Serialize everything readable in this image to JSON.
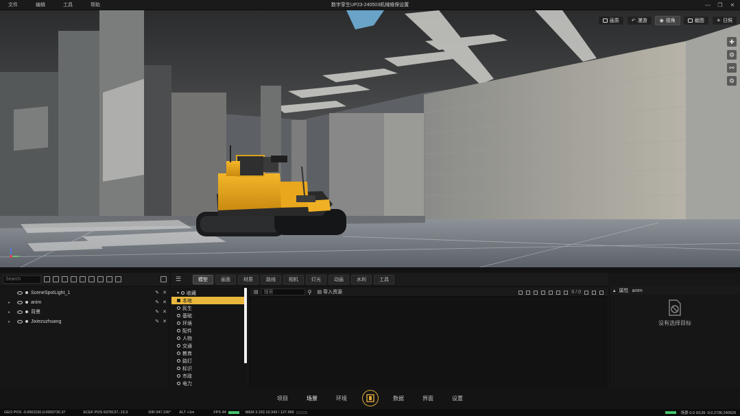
{
  "titlebar": {
    "menu": [
      "文件",
      "编辑",
      "工具",
      "帮助"
    ],
    "title": "数字孪生UP23-240503机械维保设置"
  },
  "viewport": {
    "toolbar": [
      {
        "label": "画质",
        "icon": "image-icon"
      },
      {
        "label": "漫游",
        "icon": "walk-icon"
      },
      {
        "label": "视角",
        "icon": "eye-icon"
      },
      {
        "label": "截图",
        "icon": "camera-icon"
      },
      {
        "label": "日照",
        "icon": "sun-icon"
      }
    ],
    "side_tools": [
      "move-icon",
      "gear-icon",
      "person-icon",
      "settings-icon"
    ]
  },
  "outliner": {
    "search_placeholder": "Search",
    "items": [
      {
        "name": "SceneSpotLight_1",
        "expandable": false
      },
      {
        "name": "anim",
        "expandable": true
      },
      {
        "name": "背景",
        "expandable": true
      },
      {
        "name": "Jixiezuzhuang",
        "expandable": true
      }
    ]
  },
  "library": {
    "tabs": [
      {
        "label": "模型",
        "active": true
      },
      {
        "label": "画面",
        "active": false
      },
      {
        "label": "材质",
        "active": false
      },
      {
        "label": "路线",
        "active": false
      },
      {
        "label": "相机",
        "active": false
      },
      {
        "label": "灯光",
        "active": false
      },
      {
        "label": "动画",
        "active": false
      },
      {
        "label": "水利",
        "active": false
      },
      {
        "label": "工具",
        "active": false
      }
    ],
    "categories": [
      {
        "label": "收藏",
        "selected": false,
        "group": true
      },
      {
        "label": "本地",
        "selected": true
      },
      {
        "label": "民生",
        "selected": false
      },
      {
        "label": "基础",
        "selected": false
      },
      {
        "label": "环境",
        "selected": false
      },
      {
        "label": "配件",
        "selected": false
      },
      {
        "label": "人物",
        "selected": false
      },
      {
        "label": "交通",
        "selected": false
      },
      {
        "label": "教育",
        "selected": false
      },
      {
        "label": "路灯",
        "selected": false
      },
      {
        "label": "标识",
        "selected": false
      },
      {
        "label": "市政",
        "selected": false
      },
      {
        "label": "电力",
        "selected": false
      }
    ],
    "search_placeholder": "搜索",
    "import_label": "导入资源",
    "page_counter": "0 / 0"
  },
  "properties": {
    "header_label": "属性",
    "target": "anim",
    "empty_message": "没有选择目标"
  },
  "bottom_nav": {
    "items_left": [
      {
        "label": "项目",
        "active": false
      },
      {
        "label": "场景",
        "active": true
      },
      {
        "label": "环境",
        "active": false
      }
    ],
    "items_right": [
      {
        "label": "数据",
        "active": false
      },
      {
        "label": "界面",
        "active": false
      },
      {
        "label": "设置",
        "active": false
      }
    ]
  },
  "statusbar": {
    "geo_pos": "GEO POS  -0.0001150,0.0000730.37",
    "ecef_pos": "ECEF POS  6378137,-13.3",
    "dir": "DIR  047.100°",
    "alt": "ALT  +1m",
    "fps": "FPS  44",
    "mem": "MEM  3.153  10.343 / 127.996",
    "right_text": "场景·0.0  0/139  -0.0.2736.240529"
  },
  "colors": {
    "accent": "#e8b73c",
    "panel_bg": "#171717",
    "status_green": "#46c46b"
  }
}
